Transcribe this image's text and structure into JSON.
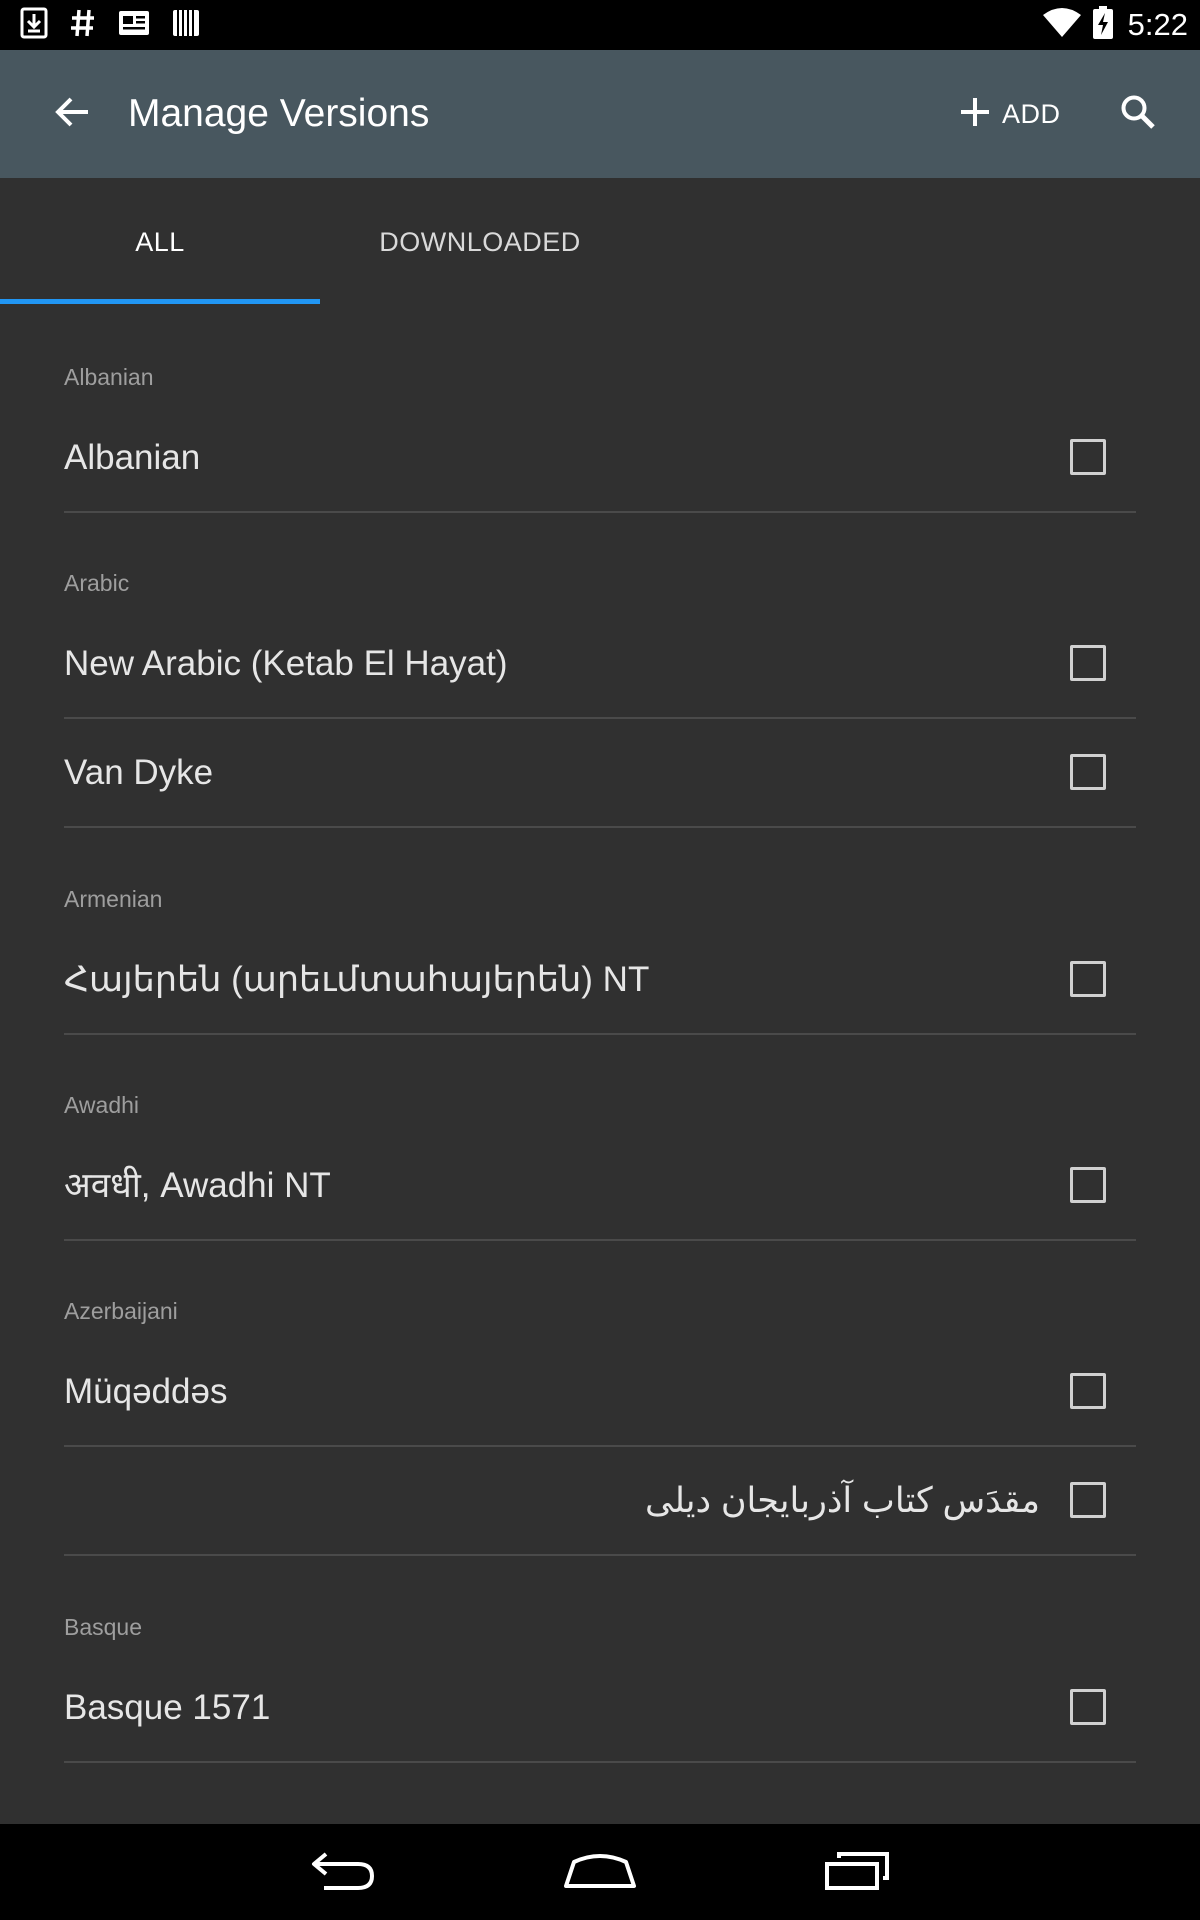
{
  "status_bar": {
    "time": "5:22",
    "notification_icons": [
      "download-icon",
      "hash-icon",
      "news-icon",
      "barcode-icon"
    ],
    "system_icons": [
      "wifi-icon",
      "battery-charging-icon"
    ]
  },
  "app_bar": {
    "title": "Manage Versions",
    "add_label": "ADD",
    "background": "#48575f"
  },
  "tabs": [
    {
      "label": "ALL",
      "active": true
    },
    {
      "label": "DOWNLOADED",
      "active": false
    }
  ],
  "accent_color": "#2196f3",
  "sections": [
    {
      "header": "Albanian",
      "items": [
        {
          "label": "Albanian",
          "checked": false
        }
      ]
    },
    {
      "header": "Arabic",
      "items": [
        {
          "label": "New Arabic (Ketab El Hayat)",
          "checked": false
        },
        {
          "label": "Van Dyke",
          "checked": false
        }
      ]
    },
    {
      "header": "Armenian",
      "items": [
        {
          "label": "Հայերեն (արեւմտահայերեն) NT",
          "checked": false
        }
      ]
    },
    {
      "header": "Awadhi",
      "items": [
        {
          "label": "अवधी, Awadhi NT",
          "checked": false
        }
      ]
    },
    {
      "header": "Azerbaijani",
      "items": [
        {
          "label": "Müqəddəs",
          "checked": false
        },
        {
          "label": "مقدَس کتاب آذربایجان دیلی",
          "checked": false
        }
      ]
    },
    {
      "header": "Basque",
      "items": [
        {
          "label": "Basque 1571",
          "checked": false
        }
      ]
    }
  ],
  "nav_bar": {
    "buttons": [
      "back-nav-icon",
      "home-nav-icon",
      "recents-nav-icon"
    ]
  }
}
